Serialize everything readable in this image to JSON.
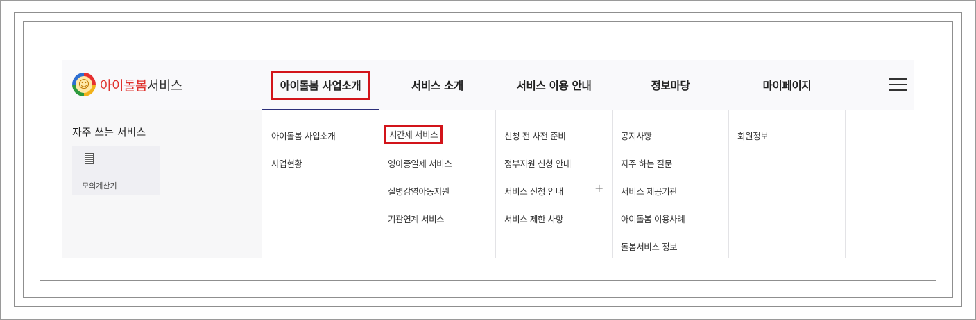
{
  "logo": {
    "name_red": "아이돌봄",
    "name_dark": "서비스"
  },
  "nav": [
    {
      "label": "아이돌봄 사업소개"
    },
    {
      "label": "서비스 소개"
    },
    {
      "label": "서비스 이용 안내"
    },
    {
      "label": "정보마당"
    },
    {
      "label": "마이페이지"
    }
  ],
  "favorites": {
    "title": "자주 쓰는 서비스",
    "item_label": "모의계산기",
    "item_icon": "calculator-icon"
  },
  "submenus": [
    {
      "items": [
        "아이돌봄 사업소개",
        "사업현황"
      ]
    },
    {
      "items": [
        "시간제 서비스",
        "영아종일제 서비스",
        "질병감염아동지원",
        "기관연계 서비스"
      ]
    },
    {
      "items": [
        "신청 전 사전 준비",
        "정부지원 신청 안내",
        "서비스 신청 안내",
        "서비스 제한 사항"
      ],
      "plus": "+"
    },
    {
      "items": [
        "공지사항",
        "자주 하는 질문",
        "서비스 제공기관",
        "아이돌봄 이용사례",
        "돌봄서비스 정보"
      ]
    },
    {
      "items": [
        "회원정보"
      ]
    }
  ],
  "highlight_color": "#d2141a",
  "active_underline_color": "#2c2f7a"
}
